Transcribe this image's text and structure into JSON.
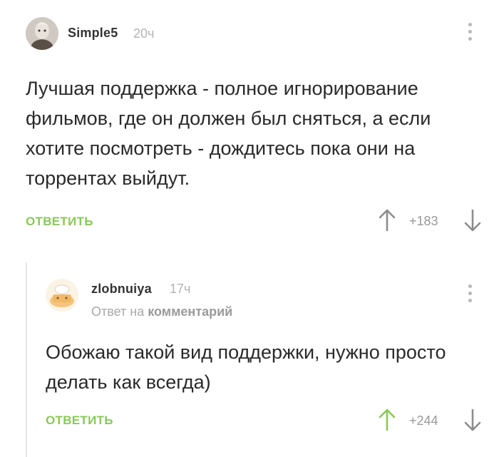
{
  "comments": [
    {
      "username": "Simple5",
      "time": "20ч",
      "text": "Лучшая поддержка - полное игнорирование фильмов, где он должен был сняться, а если хотите посмотреть - дождитесь пока они на торрентах выйдут.",
      "reply_label": "ОТВЕТИТЬ",
      "score": "+183",
      "icons": {
        "menu": "more-vertical-icon",
        "up": "arrow-up-icon",
        "down": "arrow-down-icon"
      },
      "colors": {
        "up_arrow": "#8c8c8c"
      }
    },
    {
      "username": "zlobnuiya",
      "time": "17ч",
      "reply_to_prefix": "Ответ на",
      "reply_to_link": "комментарий",
      "text": "Обожаю такой вид поддержки, нужно просто делать как всегда)",
      "reply_label": "ОТВЕТИТЬ",
      "score": "+244",
      "icons": {
        "menu": "more-vertical-icon",
        "up": "arrow-up-icon",
        "down": "arrow-down-icon"
      },
      "colors": {
        "up_arrow": "#8ac858"
      }
    }
  ],
  "colors": {
    "accent": "#8ac858",
    "muted": "#b4b4b4",
    "text": "#2a2a2a"
  }
}
